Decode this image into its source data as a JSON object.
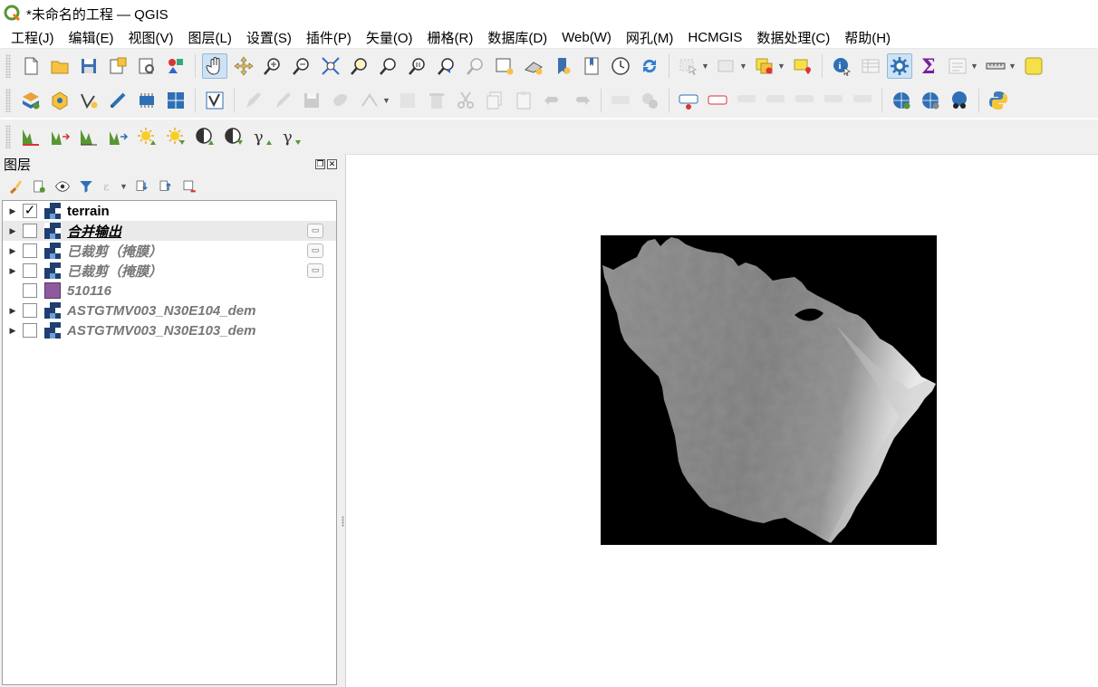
{
  "window": {
    "title": "*未命名的工程 — QGIS"
  },
  "menu": [
    "工程(J)",
    "编辑(E)",
    "视图(V)",
    "图层(L)",
    "设置(S)",
    "插件(P)",
    "矢量(O)",
    "栅格(R)",
    "数据库(D)",
    "Web(W)",
    "网孔(M)",
    "HCMGIS",
    "数据处理(C)",
    "帮助(H)"
  ],
  "layers_panel": {
    "title": "图层",
    "layers": [
      {
        "name": "terrain",
        "checked": true,
        "visible_style": "bold",
        "icon": "raster-layer-icon"
      },
      {
        "name": "合并输出",
        "checked": false,
        "visible_style": "current",
        "icon": "raster-layer-icon",
        "embedded": true
      },
      {
        "name": "已裁剪（掩膜）",
        "checked": false,
        "visible_style": "hidden",
        "icon": "raster-layer-icon",
        "embedded": true
      },
      {
        "name": "已裁剪（掩膜）",
        "checked": false,
        "visible_style": "hidden",
        "icon": "raster-layer-icon",
        "embedded": true
      },
      {
        "name": "510116",
        "checked": false,
        "visible_style": "hidden",
        "icon": "polygon-layer-icon"
      },
      {
        "name": "ASTGTMV003_N30E104_dem",
        "checked": false,
        "visible_style": "hidden",
        "icon": "raster-layer-icon"
      },
      {
        "name": "ASTGTMV003_N30E103_dem",
        "checked": false,
        "visible_style": "hidden",
        "icon": "raster-layer-icon"
      }
    ]
  },
  "colors": {
    "accent": "#589632",
    "polygon_fill": "#8e5a9e",
    "raster_bg": "#000000"
  }
}
